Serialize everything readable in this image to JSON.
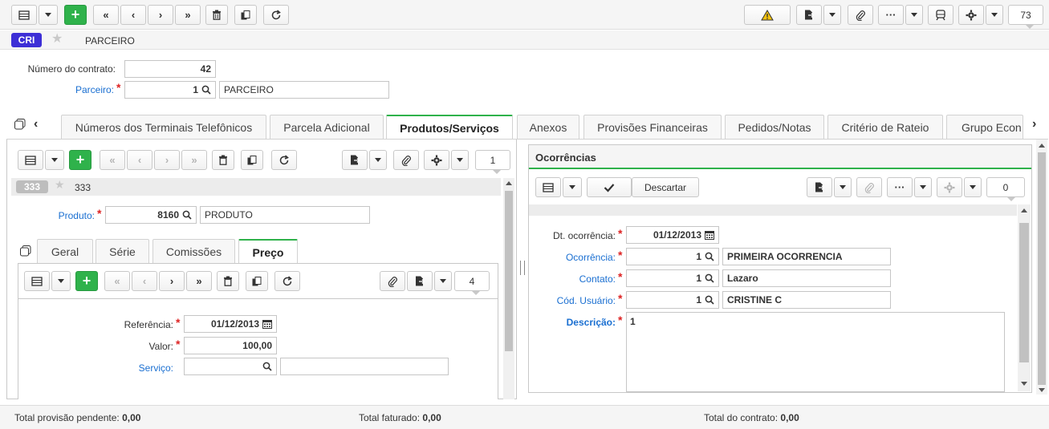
{
  "toolbar": {
    "record_counter": "73"
  },
  "header": {
    "badge": "CRI",
    "title": "PARCEIRO"
  },
  "form": {
    "contract_label": "Número do contrato:",
    "contract_value": "42",
    "partner_label": "Parceiro:",
    "partner_code": "1",
    "partner_name": "PARCEIRO"
  },
  "tabs": [
    {
      "label": "Números dos Terminais Telefônicos"
    },
    {
      "label": "Parcela Adicional"
    },
    {
      "label": "Produtos/Serviços"
    },
    {
      "label": "Anexos"
    },
    {
      "label": "Provisões Financeiras"
    },
    {
      "label": "Pedidos/Notas"
    },
    {
      "label": "Critério de Rateio"
    },
    {
      "label": "Grupo Econ"
    }
  ],
  "products": {
    "counter": "1",
    "badge": "333",
    "title": "333",
    "product_label": "Produto:",
    "product_code": "8160",
    "product_name": "PRODUTO",
    "subtabs": [
      {
        "label": "Geral"
      },
      {
        "label": "Série"
      },
      {
        "label": "Comissões"
      },
      {
        "label": "Preço"
      }
    ],
    "price": {
      "counter": "4",
      "ref_label": "Referência:",
      "ref_value": "01/12/2013",
      "value_label": "Valor:",
      "value_value": "100,00",
      "service_label": "Serviço:",
      "service_code": "",
      "service_name": ""
    }
  },
  "occurrences": {
    "title": "Ocorrências",
    "discard_label": "Descartar",
    "counter": "0",
    "date_label": "Dt. ocorrência:",
    "date_value": "01/12/2013",
    "occ_label": "Ocorrência:",
    "occ_code": "1",
    "occ_name": "PRIMEIRA OCORRENCIA",
    "contact_label": "Contato:",
    "contact_code": "1",
    "contact_name": "Lazaro",
    "user_label": "Cód. Usuário:",
    "user_code": "1",
    "user_name": "CRISTINE C",
    "desc_label": "Descrição:",
    "desc_value": "1"
  },
  "footer": {
    "pending_label": "Total provisão pendente:",
    "pending_value": "0,00",
    "billed_label": "Total faturado:",
    "billed_value": "0,00",
    "contract_total_label": "Total do contrato:",
    "contract_total_value": "0,00"
  },
  "colors": {
    "accent_green": "#2fb24b",
    "badge_purple": "#3d2fd6",
    "link_blue": "#1a6fd1",
    "required_red": "#dd2222"
  }
}
